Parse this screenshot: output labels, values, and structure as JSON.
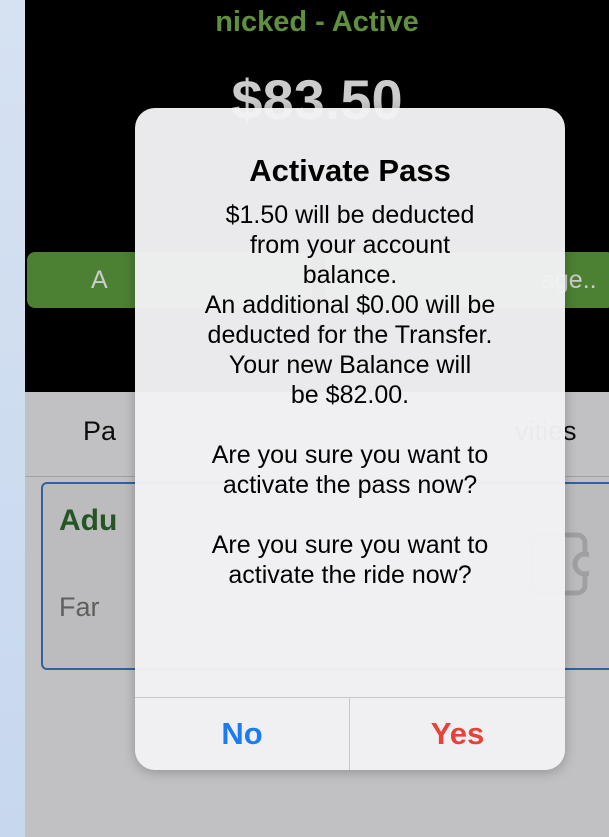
{
  "app": {
    "status_title": "nicked - Active",
    "balance": "$83.50",
    "buttons": {
      "left_label": "A",
      "right_label": "age.."
    },
    "tabs": {
      "left_label": "Pa",
      "right_label": "vities"
    },
    "card": {
      "title": "Adu",
      "subtitle": "Far",
      "icon": "ticket-icon"
    }
  },
  "dialog": {
    "title": "Activate Pass",
    "message_lines": [
      "$1.50 will be deducted",
      "from your account",
      "balance.",
      "An additional $0.00 will be",
      "deducted for the Transfer.",
      "Your new Balance will",
      "be $82.00.",
      "",
      "Are you sure you want to",
      "activate the pass now?",
      "",
      "Are you sure you want to",
      "activate the ride now?"
    ],
    "buttons": {
      "no_label": "No",
      "yes_label": "Yes"
    }
  },
  "colors": {
    "accent_green": "#79b44d",
    "button_green": "#5fa03f",
    "no_blue": "#1a7bf2",
    "yes_red": "#e8413a",
    "card_border": "#3f7ac4"
  }
}
